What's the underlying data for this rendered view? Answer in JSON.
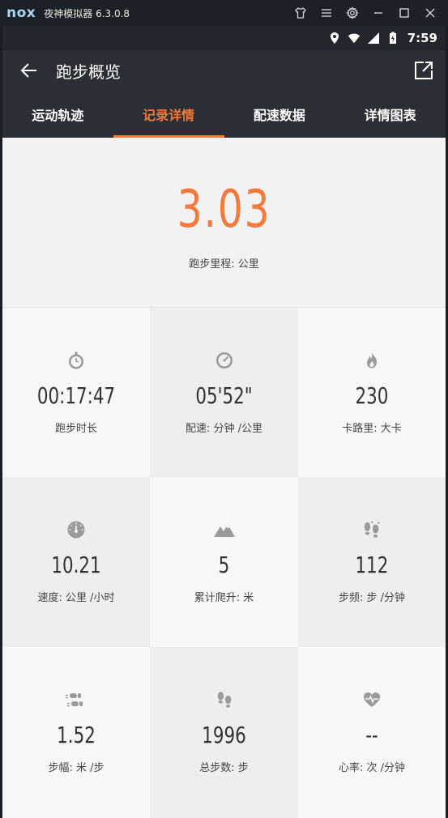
{
  "emulator": {
    "logo": "nox",
    "title": "夜神模拟器 6.3.0.8"
  },
  "status_bar": {
    "time": "7:59"
  },
  "header": {
    "title": "跑步概览"
  },
  "tabs": [
    {
      "label": "运动轨迹",
      "active": false
    },
    {
      "label": "记录详情",
      "active": true
    },
    {
      "label": "配速数据",
      "active": false
    },
    {
      "label": "详情图表",
      "active": false
    }
  ],
  "hero": {
    "value": "3.03",
    "label": "跑步里程: 公里"
  },
  "stats": [
    {
      "icon": "stopwatch-icon",
      "value": "00:17:47",
      "label": "跑步时长"
    },
    {
      "icon": "pace-gauge-icon",
      "value": "05'52\"",
      "label": "配速: 分钟 /公里"
    },
    {
      "icon": "flame-icon",
      "value": "230",
      "label": "卡路里: 大卡"
    },
    {
      "icon": "speedometer-icon",
      "value": "10.21",
      "label": "速度: 公里 /小时"
    },
    {
      "icon": "mountain-icon",
      "value": "5",
      "label": "累计爬升: 米"
    },
    {
      "icon": "footprints-icon",
      "value": "112",
      "label": "步频: 步 /分钟"
    },
    {
      "icon": "stride-icon",
      "value": "1.52",
      "label": "步幅: 米 /步"
    },
    {
      "icon": "footsteps-icon",
      "value": "1996",
      "label": "总步数: 步"
    },
    {
      "icon": "heart-rate-icon",
      "value": "--",
      "label": "心率: 次 /分钟"
    }
  ],
  "colors": {
    "accent": "#f37a3a",
    "header_bg": "#2b2e35",
    "icon_gray": "#9a9a9a"
  }
}
